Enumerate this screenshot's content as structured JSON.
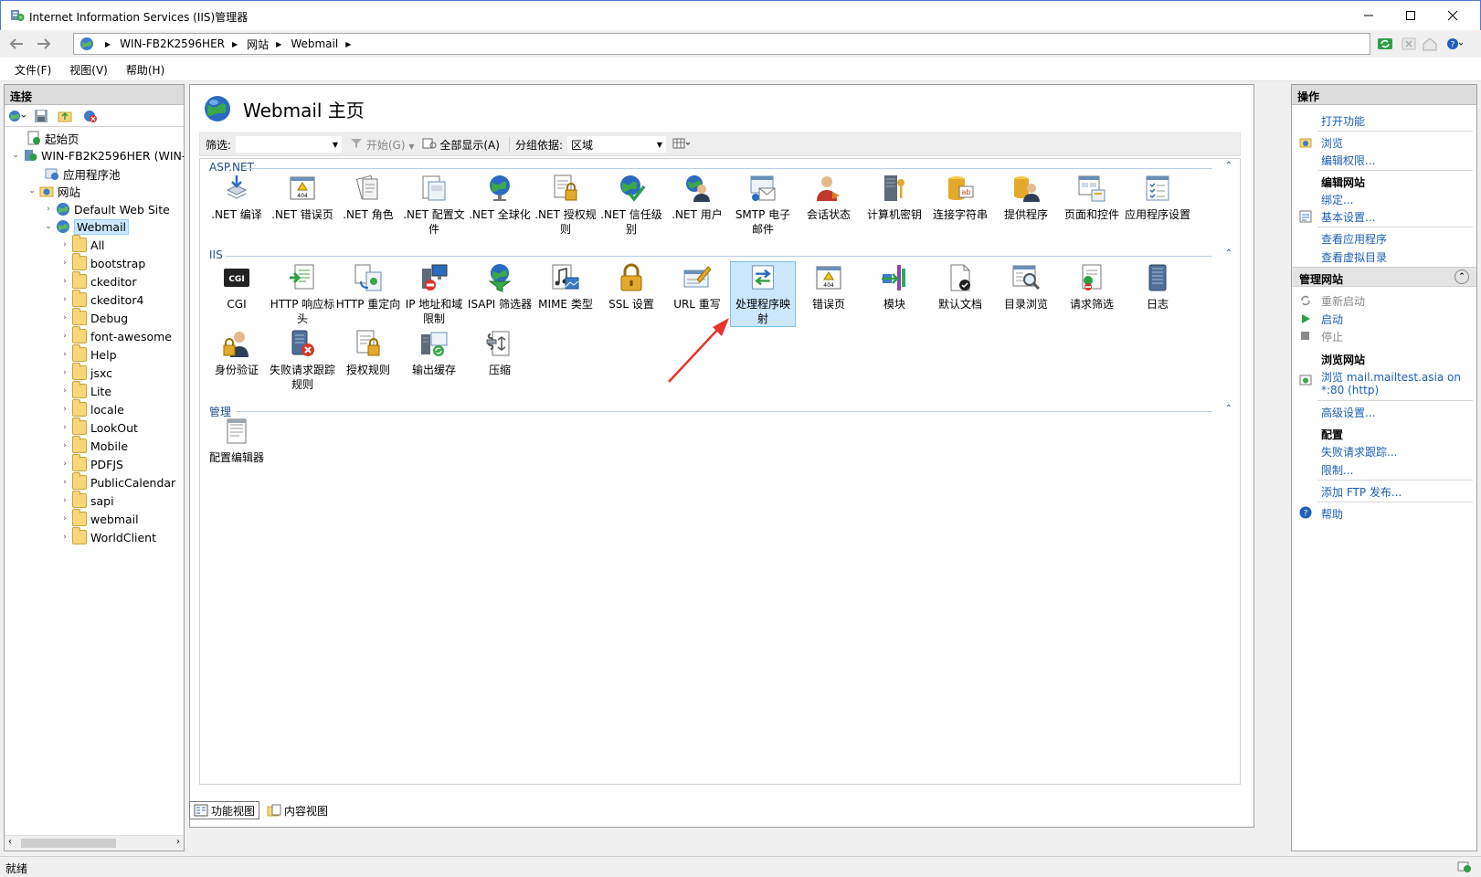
{
  "window": {
    "title": "Internet Information Services (IIS)管理器"
  },
  "address": {
    "crumbs": [
      "WIN-FB2K2596HER",
      "网站",
      "Webmail"
    ]
  },
  "menu": {
    "file": "文件(F)",
    "view": "视图(V)",
    "help": "帮助(H)"
  },
  "left": {
    "title": "连接",
    "tree": {
      "start": "起始页",
      "server": "WIN-FB2K2596HER (WIN-F",
      "apppools": "应用程序池",
      "sites": "网站",
      "default_site": "Default Web Site",
      "webmail": "Webmail",
      "folders": [
        "All",
        "bootstrap",
        "ckeditor",
        "ckeditor4",
        "Debug",
        "font-awesome",
        "Help",
        "jsxc",
        "Lite",
        "locale",
        "LookOut",
        "Mobile",
        "PDFJS",
        "PublicCalendar",
        "sapi",
        "webmail",
        "WorldClient"
      ]
    }
  },
  "center": {
    "title": "Webmail 主页",
    "filter": {
      "label": "筛选:",
      "go": "开始(G)",
      "show_all": "全部显示(A)",
      "group_label": "分组依据:",
      "group_value": "区域"
    },
    "groups": {
      "aspnet": "ASP.NET",
      "iis": "IIS",
      "manage": "管理"
    },
    "aspnet": [
      ".NET 编译",
      ".NET 错误页",
      ".NET 角色",
      ".NET 配置文件",
      ".NET 全球化",
      ".NET 授权规则",
      ".NET 信任级别",
      ".NET 用户",
      "SMTP 电子邮件",
      "会话状态",
      "计算机密钥",
      "连接字符串",
      "提供程序",
      "页面和控件",
      "应用程序设置"
    ],
    "iis_row1": [
      "CGI",
      "HTTP 响应标头",
      "HTTP 重定向",
      "IP 地址和域限制",
      "ISAPI 筛选器",
      "MIME 类型",
      "SSL 设置",
      "URL 重写",
      "处理程序映射",
      "错误页",
      "模块",
      "默认文档",
      "目录浏览",
      "请求筛选",
      "日志"
    ],
    "iis_row2": [
      "身份验证",
      "失败请求跟踪规则",
      "授权规则",
      "输出缓存",
      "压缩"
    ],
    "manage": [
      "配置编辑器"
    ],
    "tabs": {
      "features": "功能视图",
      "content": "内容视图"
    }
  },
  "right": {
    "title": "操作",
    "open_feature": "打开功能",
    "browse": "浏览",
    "edit_perms": "编辑权限...",
    "edit_site": "编辑网站",
    "bindings": "绑定...",
    "basic_settings": "基本设置...",
    "view_apps": "查看应用程序",
    "view_vdirs": "查看虚拟目录",
    "manage_site": "管理网站",
    "restart": "重新启动",
    "start": "启动",
    "stop": "停止",
    "browse_site": "浏览网站",
    "browse_link1": "浏览 mail.mailtest.asia on",
    "browse_link2": "*:80 (http)",
    "advanced": "高级设置...",
    "config": "配置",
    "failed_trace": "失败请求跟踪...",
    "limits": "限制...",
    "add_ftp": "添加 FTP 发布...",
    "help": "帮助"
  },
  "status": {
    "text": "就绪"
  }
}
